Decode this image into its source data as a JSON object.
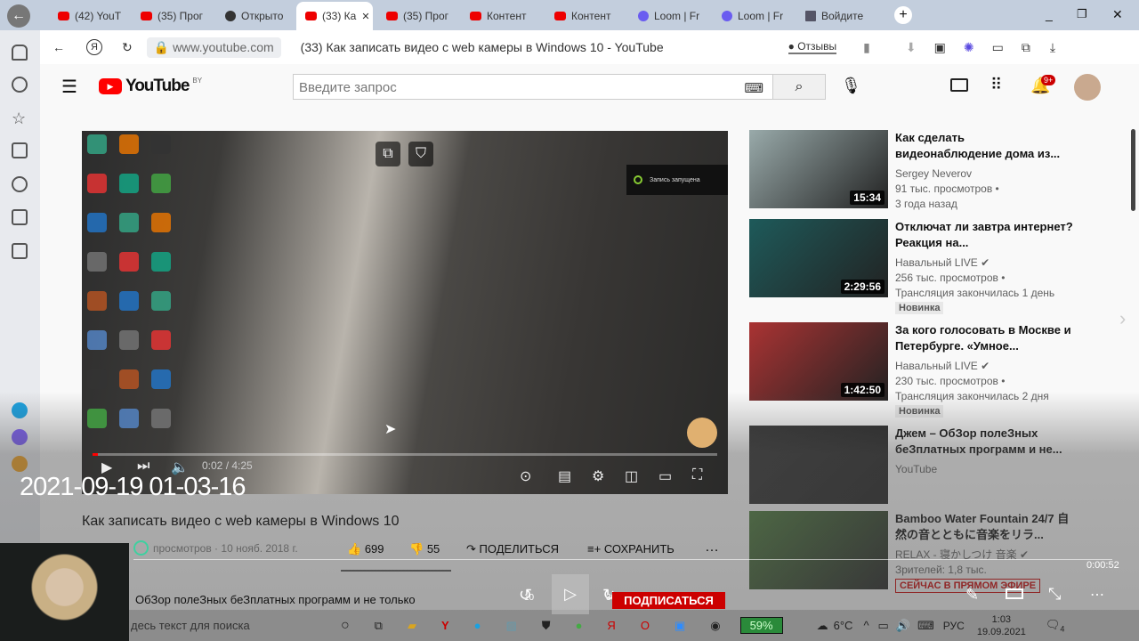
{
  "browser": {
    "tabs": [
      {
        "label": "(42) YouT",
        "icon": "youtube"
      },
      {
        "label": "(35) Прог",
        "icon": "youtube"
      },
      {
        "label": "Открыто",
        "icon": "obs"
      },
      {
        "label": "(33) Ка",
        "icon": "youtube",
        "active": true
      },
      {
        "label": "(35) Прог",
        "icon": "youtube"
      },
      {
        "label": "Контент",
        "icon": "youtube"
      },
      {
        "label": "Контент",
        "icon": "youtube"
      },
      {
        "label": "Loom | Fr",
        "icon": "loom"
      },
      {
        "label": "Loom | Fr",
        "icon": "loom"
      },
      {
        "label": "Войдите",
        "icon": "x"
      }
    ],
    "url": "www.youtube.com",
    "page_title": "(33) Как записать видео с web камеры в Windows 10 - YouTube",
    "feedback_label": "Отзывы",
    "new_tab": "+"
  },
  "youtube": {
    "logo": "YouTube",
    "logo_region": "BY",
    "search_placeholder": "Введите запрос",
    "notifications_count": "9+",
    "video": {
      "title": "Как записать видео с web камеры в Windows 10",
      "time": "0:02 / 4:25",
      "progress_fraction": 0.008,
      "meta": "просмотров · 10 нояб. 2018 г.",
      "likes": "699",
      "dislikes": "55",
      "share": "ПОДЕЛИТЬСЯ",
      "save": "СОХРАНИТЬ",
      "recorder_notice": "Запись запущена"
    },
    "channel_line": "ОбЗор полеЗных беЗплатных программ и не только",
    "subscribe": "ПОДПИСАТЬСЯ",
    "recommendations": [
      {
        "title": "Как сделать видеонаблюдение дома из...",
        "channel": "Sergey Neverov",
        "views": "91 тыс. просмотров •",
        "age": "3 года назад",
        "duration": "15:34",
        "thumb": "#9aa"
      },
      {
        "title": "Отключат ли завтра интернет? Реакция на...",
        "channel": "Навальный LIVE",
        "verified": true,
        "views": "256 тыс. просмотров •",
        "age": "Трансляция закончилась 1 день",
        "badge": "Новинка",
        "duration": "2:29:56",
        "thumb": "#1e5a5a"
      },
      {
        "title": "За кого голосовать в Москве и Петербурге. «Умное...",
        "channel": "Навальный LIVE",
        "verified": true,
        "views": "230 тыс. просмотров •",
        "age": "Трансляция закончилась 2 дня",
        "badge": "Новинка",
        "duration": "1:42:50",
        "thumb": "#a33"
      },
      {
        "title": "Джем – ОбЗор полеЗных беЗплатных программ и не...",
        "channel": "YouTube",
        "thumb": "#333"
      },
      {
        "title": "Bamboo Water Fountain 24/7 自然の音とともに音楽をリラ...",
        "channel": "RELAX - 寝かしつけ 音楽",
        "verified": true,
        "views": "Зрителей: 1,8 тыс.",
        "badge": "СЕЙЧАС В ПРЯМОМ ЭФИРЕ",
        "live": true,
        "thumb": "#4a7a3a"
      }
    ]
  },
  "recorder": {
    "timestamp": "2021-09-19 01-03-16",
    "elapsed": "0:00:52",
    "rewind": "10",
    "forward": "30"
  },
  "taskbar": {
    "search_placeholder": "десь текст для поиска",
    "battery": "59%",
    "weather": "6°C",
    "lang": "РУС",
    "time": "1:03",
    "date": "19.09.2021",
    "notifications": "4"
  }
}
